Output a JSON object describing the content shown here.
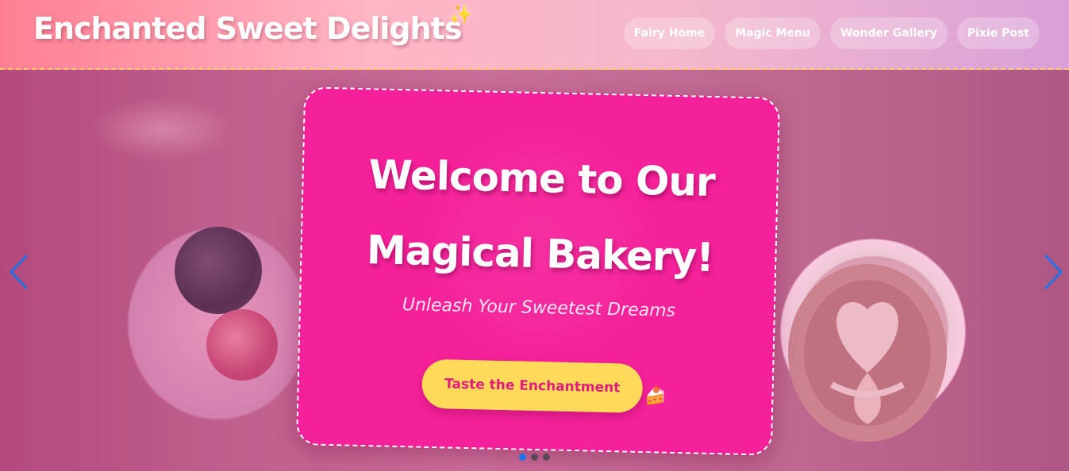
{
  "brand": {
    "title": "Enchanted Sweet Delights",
    "sparkle_icon": "sparkle-icon"
  },
  "nav": {
    "items": [
      {
        "label": "Fairy Home"
      },
      {
        "label": "Magic Menu"
      },
      {
        "label": "Wonder Gallery"
      },
      {
        "label": "Pixie Post"
      }
    ]
  },
  "hero": {
    "headline_line1": "Welcome to Our",
    "headline_line2": "Magical Bakery!",
    "tagline": "Unleash Your Sweetest Dreams",
    "cta_label": "Taste the Enchantment",
    "cta_icon": "cake-icon",
    "prev_icon": "chevron-left-icon",
    "next_icon": "chevron-right-icon",
    "slides_total": 3,
    "active_slide": 1
  },
  "colors": {
    "accent": "#f5219a",
    "cta_bg": "#ffd95a",
    "cta_text": "#e01d7d",
    "arrow": "#1e73e8",
    "header_border": "#ffd166"
  }
}
